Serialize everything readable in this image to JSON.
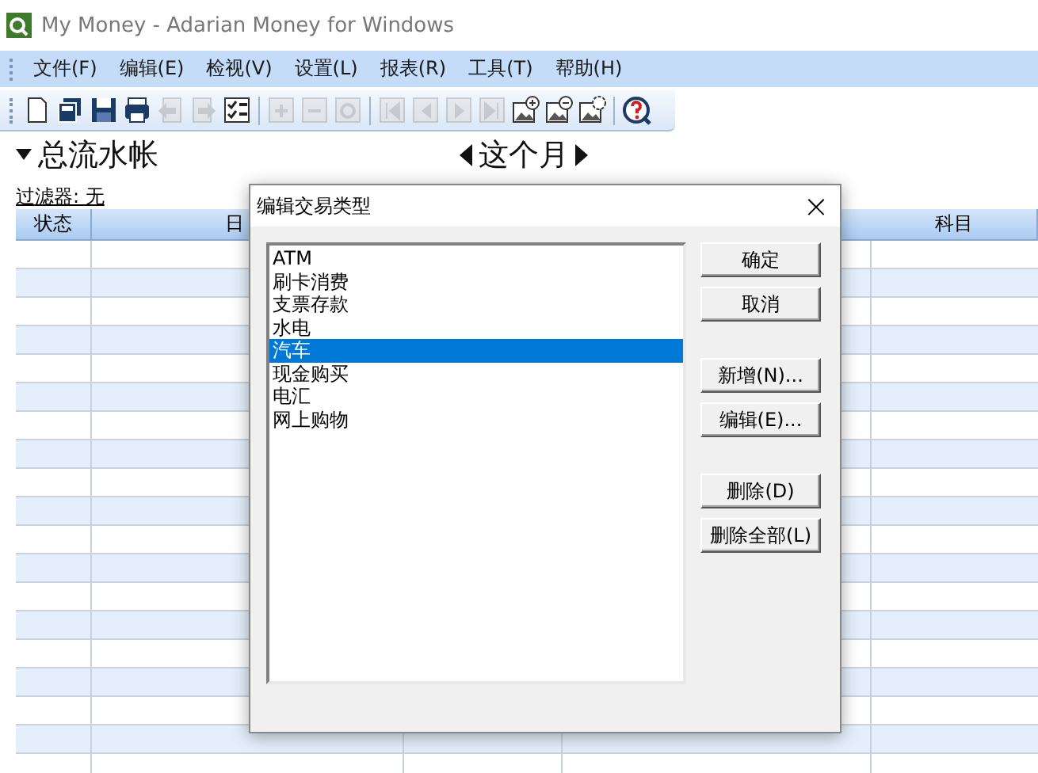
{
  "window": {
    "title": "My Money - Adarian Money for Windows"
  },
  "menu": [
    "文件(F)",
    "编辑(E)",
    "检视(V)",
    "设置(L)",
    "报表(R)",
    "工具(T)",
    "帮助(H)"
  ],
  "toolbar": [
    {
      "kind": "new",
      "disabled": false
    },
    {
      "kind": "copy",
      "disabled": false
    },
    {
      "kind": "save",
      "disabled": false
    },
    {
      "kind": "print",
      "disabled": false
    },
    {
      "kind": "back",
      "disabled": true
    },
    {
      "kind": "forward",
      "disabled": true
    },
    {
      "kind": "checklist",
      "disabled": false
    },
    {
      "kind": "sep"
    },
    {
      "kind": "plus",
      "disabled": true
    },
    {
      "kind": "minus",
      "disabled": true
    },
    {
      "kind": "ring",
      "disabled": true
    },
    {
      "kind": "sep"
    },
    {
      "kind": "first",
      "disabled": true
    },
    {
      "kind": "prev",
      "disabled": true
    },
    {
      "kind": "next",
      "disabled": true
    },
    {
      "kind": "last",
      "disabled": true
    },
    {
      "kind": "imgplus",
      "disabled": false
    },
    {
      "kind": "imgminus",
      "disabled": false
    },
    {
      "kind": "imggear",
      "disabled": false
    },
    {
      "kind": "sep"
    },
    {
      "kind": "help",
      "disabled": false
    }
  ],
  "ledger": {
    "title": "总流水帐",
    "period": "这个月",
    "filter": "过滤器: 无"
  },
  "table": {
    "columns": [
      "状态",
      "日",
      "科目"
    ]
  },
  "dialog": {
    "title": "编辑交易类型",
    "close": "×",
    "items": [
      {
        "label": "ATM",
        "selected": false
      },
      {
        "label": "刷卡消费",
        "selected": false
      },
      {
        "label": "支票存款",
        "selected": false
      },
      {
        "label": "水电",
        "selected": false
      },
      {
        "label": "汽车",
        "selected": true
      },
      {
        "label": "现金购买",
        "selected": false
      },
      {
        "label": "电汇",
        "selected": false
      },
      {
        "label": "网上购物",
        "selected": false
      }
    ],
    "buttons": [
      "确定",
      "取消",
      "新增(N)...",
      "编辑(E)...",
      "删除(D)",
      "删除全部(L)"
    ]
  }
}
